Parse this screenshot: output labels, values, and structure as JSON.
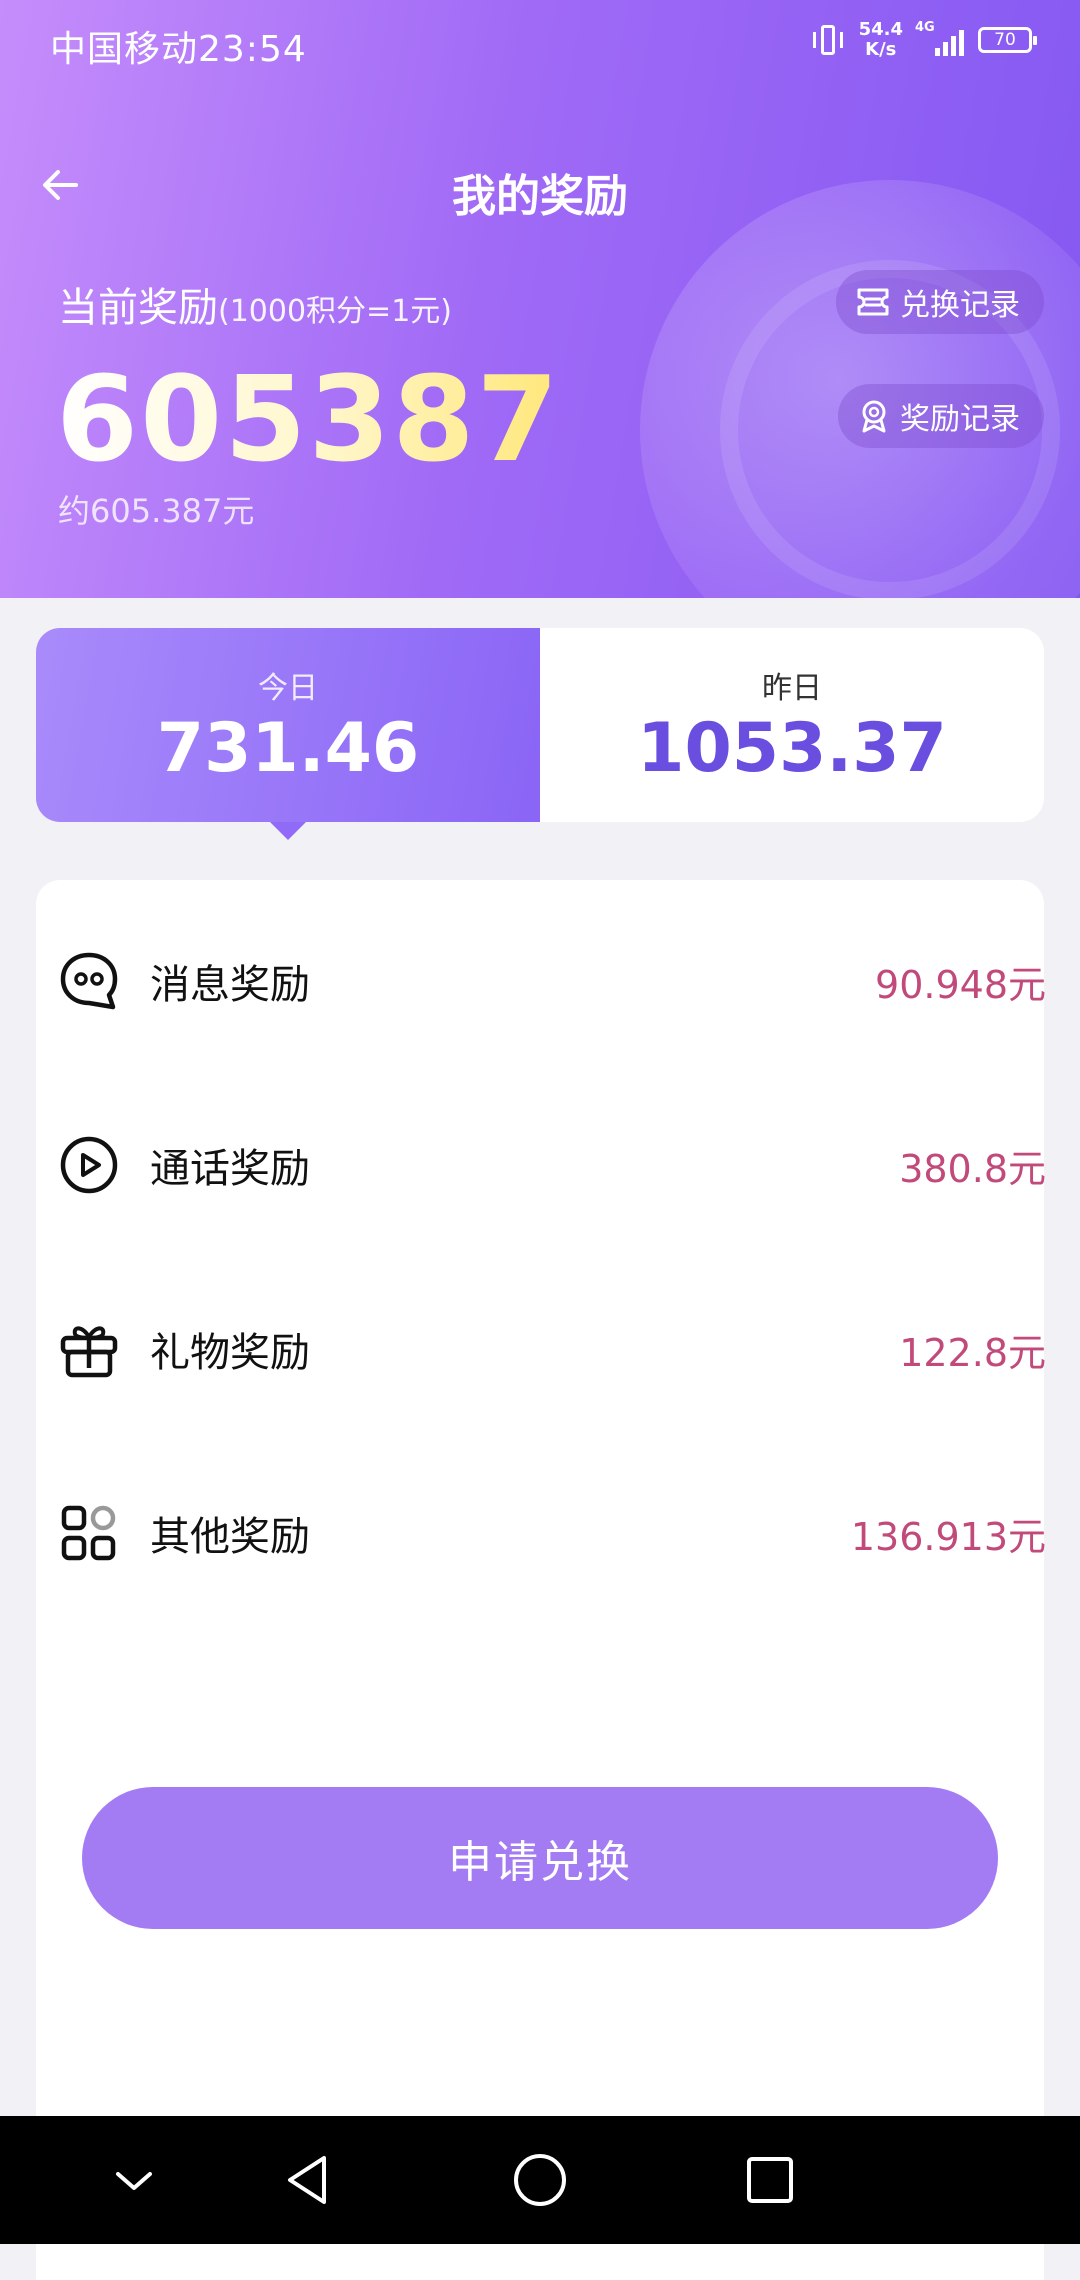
{
  "status_bar": {
    "carrier_time": "中国移动23:54",
    "net_speed_value": "54.4",
    "net_speed_unit": "K/s",
    "network_type": "4G",
    "battery": "70"
  },
  "header": {
    "title": "我的奖励",
    "current_reward_label": "当前奖励",
    "rate_note": "(1000积分=1元)",
    "points": "605387",
    "approx_value": "约605.387元",
    "exchange_record_label": "兑换记录",
    "reward_record_label": "奖励记录"
  },
  "day_tabs": {
    "today_label": "今日",
    "today_value": "731.46",
    "yesterday_label": "昨日",
    "yesterday_value": "1053.37",
    "selected": "today"
  },
  "rewards": [
    {
      "label": "消息奖励",
      "amount": "90.948元",
      "icon": "message-icon"
    },
    {
      "label": "通话奖励",
      "amount": "380.8元",
      "icon": "video-call-icon"
    },
    {
      "label": "礼物奖励",
      "amount": "122.8元",
      "icon": "gift-icon"
    },
    {
      "label": "其他奖励",
      "amount": "136.913元",
      "icon": "grid-apps-icon"
    }
  ],
  "apply_button_label": "申请兑换",
  "colors": {
    "header_gradient_start": "#c58dfb",
    "header_gradient_end": "#8458f2",
    "accent_purple": "#a37cf4",
    "amount_pink": "#c14a7a",
    "yesterday_value": "#6a4ee0"
  }
}
